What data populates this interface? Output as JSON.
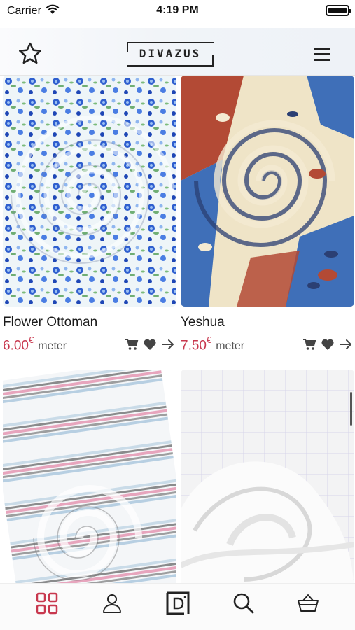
{
  "status_bar": {
    "carrier": "Carrier",
    "time": "4:19 PM",
    "icons": [
      "wifi-icon",
      "battery-icon"
    ]
  },
  "header": {
    "logo_text": "DIVAZUS",
    "icons": [
      "star-icon",
      "hamburger-menu-icon"
    ]
  },
  "products": [
    {
      "title": "Flower Ottoman",
      "price": "6.00",
      "currency": "€",
      "unit": "meter",
      "pattern": "blue floral on white"
    },
    {
      "title": "Yeshua",
      "price": "7.50",
      "currency": "€",
      "unit": "meter",
      "pattern": "red and blue paisley on cream"
    },
    {
      "title": "",
      "price": "",
      "currency": "",
      "unit": "",
      "pattern": "pink and black striped"
    },
    {
      "title": "",
      "price": "",
      "currency": "",
      "unit": "",
      "pattern": "plain white"
    }
  ],
  "product_action_icons": [
    "cart-icon",
    "heart-icon",
    "arrow-right-icon"
  ],
  "tabbar": {
    "tabs": [
      {
        "name": "grid",
        "icon": "grid-icon",
        "active": true
      },
      {
        "name": "account",
        "icon": "user-icon",
        "active": false
      },
      {
        "name": "brand",
        "icon": "divazus-d-icon",
        "active": false
      },
      {
        "name": "search",
        "icon": "search-icon",
        "active": false
      },
      {
        "name": "basket",
        "icon": "basket-icon",
        "active": false
      }
    ]
  },
  "colors": {
    "price": "#c8384e",
    "active_tab": "#c8384e",
    "text": "#1a1a1a",
    "icon": "#444444"
  }
}
